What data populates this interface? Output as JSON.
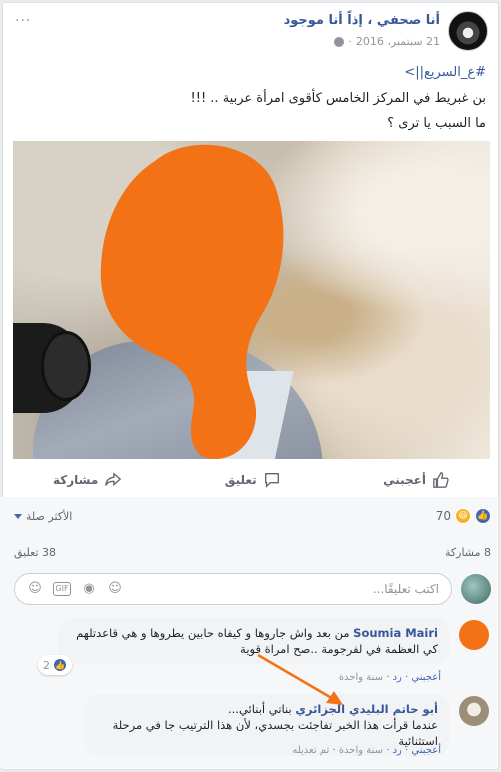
{
  "post": {
    "author": "أنا صحفي ، إذاً أنا موجود",
    "date": "21 سبتمبر، 2016",
    "date_sep": "·",
    "more_label": "···",
    "line1_hashtag": "#ع_السريع||>",
    "line2": "بن غبريط في المركز الخامس كأقوى امرأة عربية .. !!!",
    "line3": "ما السبب يا ترى ؟"
  },
  "actions": {
    "like": "أعجبني",
    "comment": "تعليق",
    "share": "مشاركة"
  },
  "stats": {
    "reactions_count": "70",
    "sort_label": "الأكثر صلة",
    "shares": "8 مشاركة",
    "comments": "38 تعليق"
  },
  "compose": {
    "placeholder": "اكتب تعليقًا..."
  },
  "comments": [
    {
      "name": "Soumia Mairi",
      "text": " من بعد واش جاروها و كيفاه حابين يطروها و هي قاعدتلهم كي العظمة في لفرجومة ..صح امراة قوية",
      "like": "أعجبني",
      "reply": "رد",
      "time": "سنة واحدة",
      "likes": "2"
    },
    {
      "name": "أبو حاتم البليدي الجزائري",
      "text": " بناتي أبنائي...",
      "text2": "عندما قرأت هذا الخبر تفاجئت بجسدي، لأن هذا الترتيب جا في مرحلة استثنائية",
      "like": "أعجبني",
      "reply": "رد",
      "time": "سنة واحدة",
      "edit": "تم تعديله"
    }
  ],
  "colors": {
    "link": "#365899",
    "accent": "#4267b2",
    "annotation": "#f47216"
  }
}
